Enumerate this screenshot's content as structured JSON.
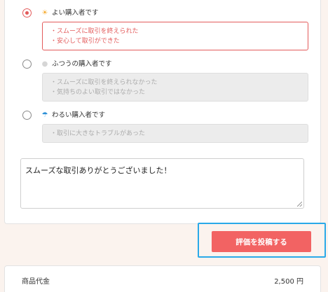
{
  "options": [
    {
      "label": "よい購入者です",
      "icon": "sun-icon",
      "selected": true,
      "descriptions": [
        "・スムーズに取引を終えられた",
        "・安心して取引ができた"
      ]
    },
    {
      "label": "ふつうの購入者です",
      "icon": "cloud-icon",
      "selected": false,
      "descriptions": [
        "・スムーズに取引を終えられなかった",
        "・気持ちのよい取引ではなかった"
      ]
    },
    {
      "label": "わるい購入者です",
      "icon": "umbrella-icon",
      "selected": false,
      "descriptions": [
        "・取引に大きなトラブルがあった"
      ]
    }
  ],
  "comment": {
    "value": "スムーズな取引ありがとうございました！"
  },
  "submit": {
    "label": "評価を投稿する"
  },
  "price": {
    "label": "商品代金",
    "value": "2,500 円"
  },
  "colors": {
    "accent": "#e35b5b",
    "button": "#f26363",
    "highlight": "#29a9e8",
    "background": "#fbf3ee"
  }
}
